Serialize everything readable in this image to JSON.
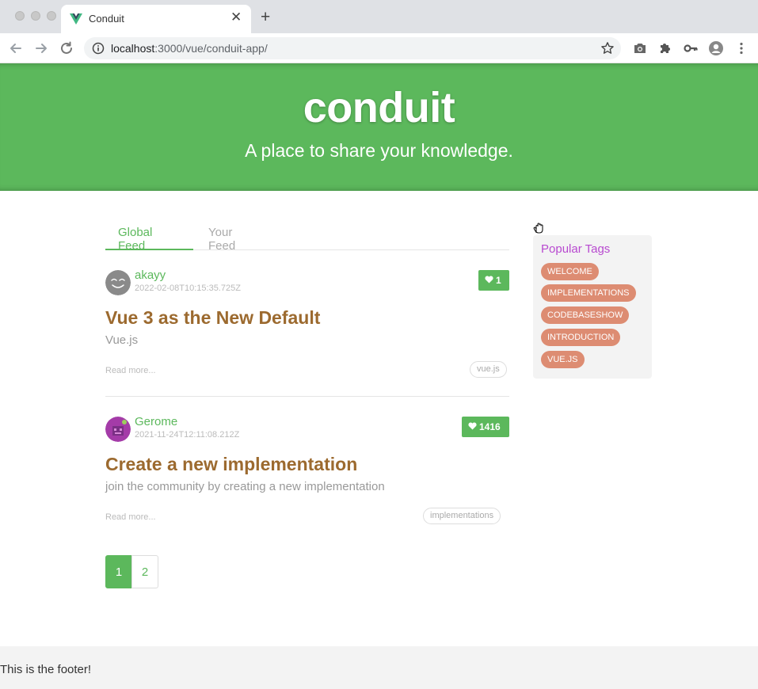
{
  "browser": {
    "tab_title": "Conduit",
    "tab_close": "✕",
    "new_tab": "+",
    "url_host": "localhost",
    "url_rest": ":3000/vue/conduit-app/"
  },
  "banner": {
    "logo": "conduit",
    "tagline": "A place to share your knowledge."
  },
  "feed_tabs": [
    {
      "label": "Global Feed",
      "active": true
    },
    {
      "label": "Your Feed",
      "active": false
    }
  ],
  "articles": [
    {
      "author": "akayy",
      "date": "2022-02-08T10:15:35.725Z",
      "favorites": "1",
      "title": "Vue 3 as the New Default",
      "description": "Vue.js",
      "read_more": "Read more...",
      "tag": "vue.js"
    },
    {
      "author": "Gerome",
      "date": "2021-11-24T12:11:08.212Z",
      "favorites": "1416",
      "title": "Create a new implementation",
      "description": "join the community by creating a new implementation",
      "read_more": "Read more...",
      "tag": "implementations"
    }
  ],
  "pagination": [
    "1",
    "2"
  ],
  "sidebar": {
    "title": "Popular Tags",
    "tags": [
      "WELCOME",
      "IMPLEMENTATIONS",
      "CODEBASESHOW",
      "INTRODUCTION",
      "VUE.JS"
    ]
  },
  "footer": {
    "text": "This is the footer!"
  },
  "colors": {
    "brand_green": "#5cb85c",
    "title_brown": "#9c6a2f",
    "tag_pill": "#dd8c72",
    "sidebar_title": "#b84ad0"
  }
}
